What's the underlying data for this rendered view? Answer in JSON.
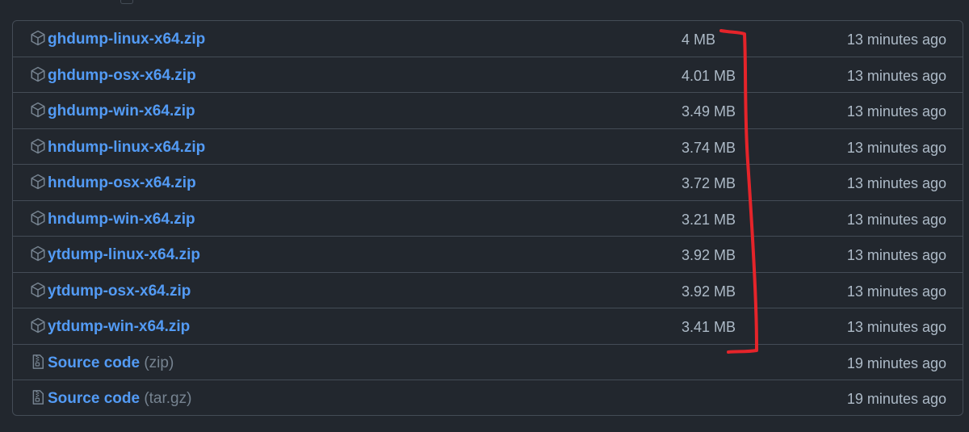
{
  "assets": [
    {
      "name": "ghdump-linux-x64.zip",
      "suffix": "",
      "size": "4 MB",
      "time": "13 minutes ago",
      "icon": "package-icon"
    },
    {
      "name": "ghdump-osx-x64.zip",
      "suffix": "",
      "size": "4.01 MB",
      "time": "13 minutes ago",
      "icon": "package-icon"
    },
    {
      "name": "ghdump-win-x64.zip",
      "suffix": "",
      "size": "3.49 MB",
      "time": "13 minutes ago",
      "icon": "package-icon"
    },
    {
      "name": "hndump-linux-x64.zip",
      "suffix": "",
      "size": "3.74 MB",
      "time": "13 minutes ago",
      "icon": "package-icon"
    },
    {
      "name": "hndump-osx-x64.zip",
      "suffix": "",
      "size": "3.72 MB",
      "time": "13 minutes ago",
      "icon": "package-icon"
    },
    {
      "name": "hndump-win-x64.zip",
      "suffix": "",
      "size": "3.21 MB",
      "time": "13 minutes ago",
      "icon": "package-icon"
    },
    {
      "name": "ytdump-linux-x64.zip",
      "suffix": "",
      "size": "3.92 MB",
      "time": "13 minutes ago",
      "icon": "package-icon"
    },
    {
      "name": "ytdump-osx-x64.zip",
      "suffix": "",
      "size": "3.92 MB",
      "time": "13 minutes ago",
      "icon": "package-icon"
    },
    {
      "name": "ytdump-win-x64.zip",
      "suffix": "",
      "size": "3.41 MB",
      "time": "13 minutes ago",
      "icon": "package-icon"
    },
    {
      "name": "Source code",
      "suffix": "(zip)",
      "size": "",
      "time": "19 minutes ago",
      "icon": "file-zip-icon"
    },
    {
      "name": "Source code",
      "suffix": "(tar.gz)",
      "size": "",
      "time": "19 minutes ago",
      "icon": "file-zip-icon"
    }
  ],
  "colors": {
    "background": "#22272e",
    "border": "#444c56",
    "link": "#539bf5",
    "text": "#adbac7",
    "muted": "#768390",
    "annotation": "#e5242a"
  }
}
